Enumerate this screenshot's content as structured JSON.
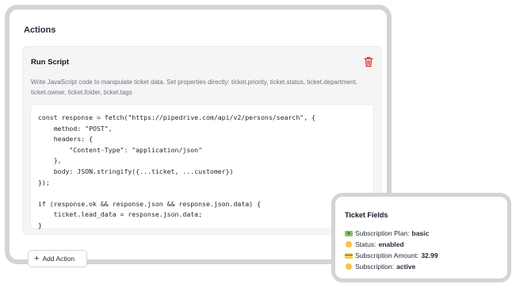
{
  "actions": {
    "title": "Actions",
    "script_card": {
      "title": "Run Script",
      "description": "Write JavaScript code to manipulate ticket data. Set properties directly: ticket.priority, ticket.status, ticket.department, ticket.owner, ticket.folder, ticket.tags",
      "code": "const response = fetch(\"https://pipedrive.com/api/v2/persons/search\", {\n    method: \"POST\",\n    headers: {\n        \"Content-Type\": \"application/json\"\n    },\n    body: JSON.stringify({...ticket, ...customer})\n});\n\nif (response.ok && response.json && response.json.data) {\n    ticket.lead_data = response.json.data;\n}",
      "delete_icon": "trash-icon"
    },
    "add_action_label": "Add Action"
  },
  "ticket_fields": {
    "title": "Ticket Fields",
    "rows": [
      {
        "icon": "money-icon",
        "label": "Subscription Plan:",
        "value": "basic"
      },
      {
        "icon": "yellow-circle-icon",
        "label": "Status:",
        "value": "enabled"
      },
      {
        "icon": "credit-card-icon",
        "label": "Subscription Amount:",
        "value": "32.99"
      },
      {
        "icon": "yellow-circle-icon",
        "label": "Subscription:",
        "value": "active"
      }
    ]
  },
  "colors": {
    "frame": "#d4d4d4",
    "delete_icon": "#dc2626",
    "card_bg": "#f5f5f5"
  }
}
